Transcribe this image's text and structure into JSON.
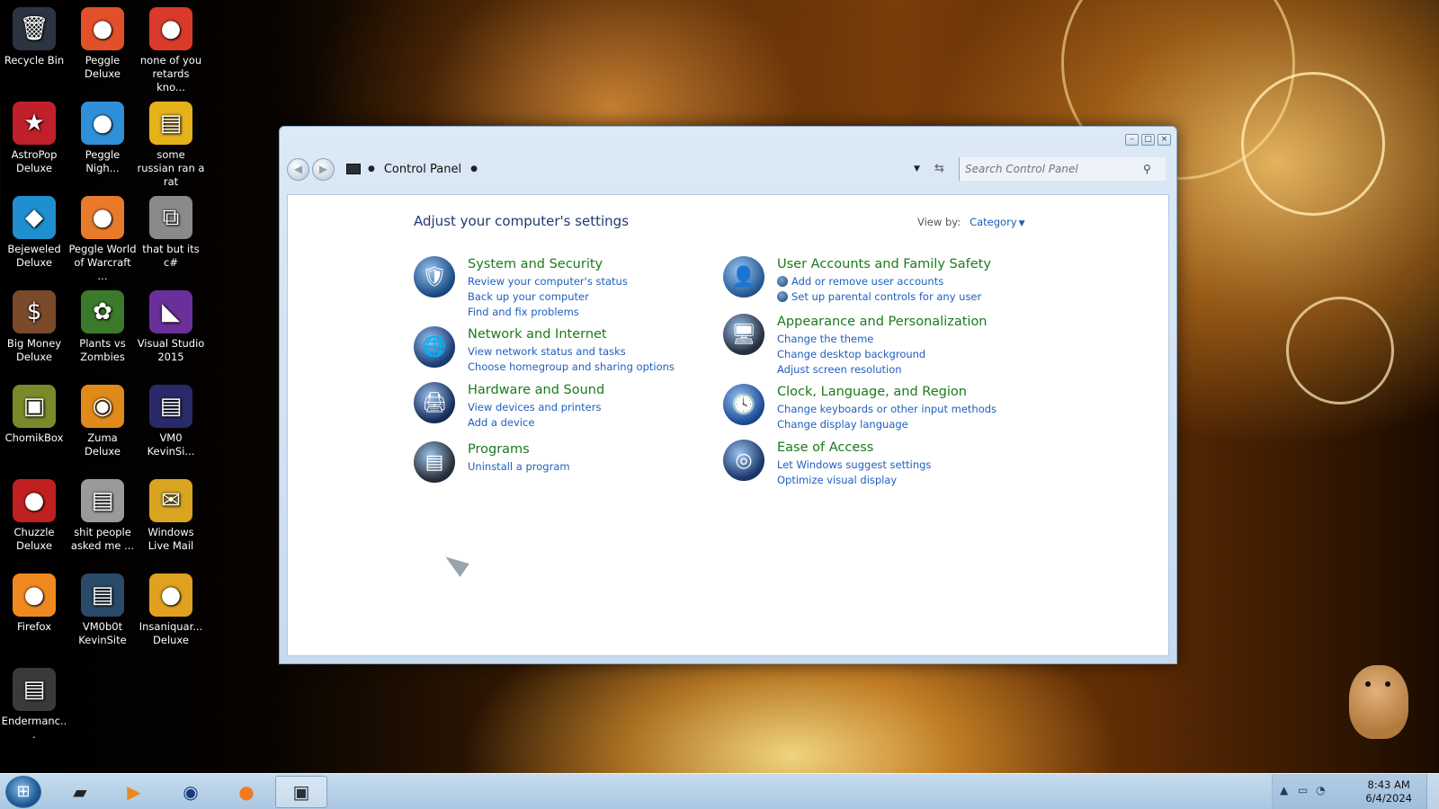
{
  "desktop": {
    "icons": [
      {
        "label": "Recycle Bin",
        "icon": "recycle-bin-icon",
        "color": "#2b3440"
      },
      {
        "label": "Peggle Deluxe",
        "icon": "peggle-icon",
        "color": "#e2502a"
      },
      {
        "label": "none of you retards kno...",
        "icon": "peggle-shortcut-icon",
        "color": "#d93a2a"
      },
      {
        "label": "AstroPop Deluxe",
        "icon": "astropop-icon",
        "color": "#c0202a"
      },
      {
        "label": "Peggle Nigh...",
        "icon": "peggle-nights-icon",
        "color": "#2f8fd8"
      },
      {
        "label": "some russian ran a rat",
        "icon": "text-file-icon",
        "color": "#e6b21a"
      },
      {
        "label": "Bejeweled Deluxe",
        "icon": "bejeweled-icon",
        "color": "#1f8fd0"
      },
      {
        "label": "Peggle World of Warcraft ...",
        "icon": "peggle-wow-icon",
        "color": "#e87a2a"
      },
      {
        "label": "that but its c#",
        "icon": "shortcut-icon",
        "color": "#8a8a8a"
      },
      {
        "label": "Big Money Deluxe",
        "icon": "big-money-icon",
        "color": "#7a4a2a"
      },
      {
        "label": "Plants vs Zombies",
        "icon": "plants-vs-zombies-icon",
        "color": "#3a7a2a"
      },
      {
        "label": "Visual Studio 2015",
        "icon": "visual-studio-icon",
        "color": "#6a2f9a"
      },
      {
        "label": "ChomikBox",
        "icon": "chomikbox-icon",
        "color": "#7a8a2a"
      },
      {
        "label": "Zuma Deluxe",
        "icon": "zuma-icon",
        "color": "#e08a1a"
      },
      {
        "label": "VM0 KevinSi...",
        "icon": "vm-file-icon",
        "color": "#2a2a6a"
      },
      {
        "label": "Chuzzle Deluxe",
        "icon": "chuzzle-icon",
        "color": "#c02020"
      },
      {
        "label": "shit people asked me ...",
        "icon": "document-icon",
        "color": "#9a9a9a"
      },
      {
        "label": "Windows Live Mail",
        "icon": "live-mail-icon",
        "color": "#d9a520"
      },
      {
        "label": "Firefox",
        "icon": "firefox-icon",
        "color": "#f08a20"
      },
      {
        "label": "VM0b0t KevinSite",
        "icon": "vm-site-icon",
        "color": "#2a4a6a"
      },
      {
        "label": "Insaniquar... Deluxe",
        "icon": "insaniquarium-icon",
        "color": "#e0a020"
      },
      {
        "label": "Endermanc...",
        "icon": "endermanch-icon",
        "color": "#3a3a3a"
      }
    ]
  },
  "window": {
    "breadcrumb": "Control Panel",
    "search_placeholder": "Search Control Panel",
    "title": "Adjust your computer's settings",
    "view_by_label": "View by:",
    "view_by_value": "Category",
    "categories_left": [
      {
        "title": "System and Security",
        "icon": "system-security-icon",
        "color": "#1d4f8a",
        "links": [
          "Review your computer's status",
          "Back up your computer",
          "Find and fix problems"
        ]
      },
      {
        "title": "Network and Internet",
        "icon": "network-internet-icon",
        "color": "#1d3f7a",
        "links": [
          "View network status and tasks",
          "Choose homegroup and sharing options"
        ]
      },
      {
        "title": "Hardware and Sound",
        "icon": "hardware-sound-icon",
        "color": "#1c2f5e",
        "links": [
          "View devices and printers",
          "Add a device"
        ]
      },
      {
        "title": "Programs",
        "icon": "programs-icon",
        "color": "#2a2f38",
        "links": [
          "Uninstall a program"
        ]
      }
    ],
    "categories_right": [
      {
        "title": "User Accounts and Family Safety",
        "icon": "user-accounts-icon",
        "color": "#2a5f9a",
        "links": [
          "Add or remove user accounts",
          "Set up parental controls for any user"
        ]
      },
      {
        "title": "Appearance and Personalization",
        "icon": "appearance-icon",
        "color": "#2a3140",
        "links": [
          "Change the theme",
          "Change desktop background",
          "Adjust screen resolution"
        ]
      },
      {
        "title": "Clock, Language, and Region",
        "icon": "clock-language-icon",
        "color": "#1f4f9a",
        "links": [
          "Change keyboards or other input methods",
          "Change display language"
        ]
      },
      {
        "title": "Ease of Access",
        "icon": "ease-of-access-icon",
        "color": "#1d3a6e",
        "links": [
          "Let Windows suggest settings",
          "Optimize visual display"
        ]
      }
    ]
  },
  "taskbar": {
    "clock_time": "8:43 AM",
    "clock_date": "6/4/2024",
    "apps": [
      {
        "name": "explorer-taskbar-icon",
        "color": "#222"
      },
      {
        "name": "media-player-taskbar-icon",
        "color": "#e88a20"
      },
      {
        "name": "ie-taskbar-icon",
        "color": "#1a3a7a"
      },
      {
        "name": "firefox-taskbar-icon",
        "color": "#f07a20"
      },
      {
        "name": "control-panel-taskbar-icon",
        "color": "#2a2f38"
      }
    ]
  }
}
